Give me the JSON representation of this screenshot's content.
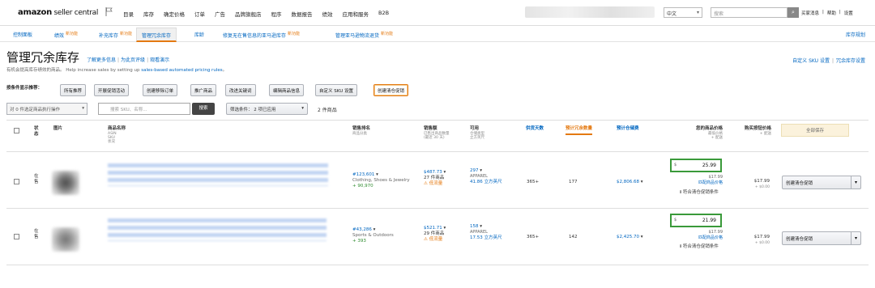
{
  "header": {
    "logo_main": "amazon",
    "logo_sub": " seller central",
    "nav": [
      "目录",
      "库存",
      "确定价格",
      "订单",
      "广告",
      "品牌旗舰店",
      "程序",
      "数据报告",
      "绩效",
      "应用和服务",
      "B2B"
    ],
    "language": "中文",
    "search_placeholder": "搜索",
    "links": [
      "买家消息",
      "帮助",
      "设置"
    ]
  },
  "tabs": [
    {
      "label": "控制面板",
      "badge": ""
    },
    {
      "label": "绩效",
      "badge": "新功能"
    },
    {
      "label": "补充库存",
      "badge": "新功能"
    },
    {
      "label": "管理冗余库存",
      "badge": ""
    },
    {
      "label": "库龄",
      "badge": ""
    },
    {
      "label": "修复无在售信息的亚马逊库存",
      "badge": "新功能"
    },
    {
      "label": "管理亚马逊物流退货",
      "badge": "新功能"
    }
  ],
  "tab_right": "库存规划",
  "page": {
    "title": "管理冗余库存",
    "link_learn": "了解更多信息",
    "link_rate": "为此页评级",
    "link_demo": "观看演示",
    "subtitle": "有机会提高库存绩效的商品。 Help increase sales by setting up ",
    "subtitle_link": "sales-based automated pricing rules",
    "subtitle_end": "。",
    "right_link_1": "自定义 SKU 设置",
    "right_link_2": "冗余库存设置"
  },
  "recommendations": {
    "label": "按条件显示推荐：",
    "buttons": [
      "所有推荐",
      "开展促销活动",
      "创建移除订单",
      "推广商品",
      "改进关键词",
      "编辑商品信息",
      "自定义 SKU 设置",
      "创建清仓促销"
    ],
    "selected": "创建清仓促销"
  },
  "toolbar": {
    "bulk": "对 0 件选定商品执行操作",
    "search_placeholder": "搜索 SKU、名称...",
    "search_button": "搜索",
    "filter": "筛选条件： 2 项已应用",
    "count": "2 件商品"
  },
  "columns": {
    "status": "状态",
    "image": "图片",
    "name": "商品名称",
    "name_sub": [
      "ASIN",
      "SKU",
      "状况"
    ],
    "rank": "销售排名",
    "rank_sub": "商品分类",
    "sales": "销售额",
    "sales_sub": "已售出商品数量",
    "sales_period": "(最近 30 天)",
    "available": "可用",
    "available_sub": [
      "仓储类型",
      "立方英尺"
    ],
    "supply_days": "供货天数",
    "excess_units": "预计冗余数量",
    "excess_cost": "预计仓储费",
    "your_price": "您的商品价格",
    "your_price_sub": [
      "最低价格",
      "+ 配送"
    ],
    "buybox": "购买按钮价格",
    "buybox_sub": "+ 配送",
    "save_all": "全部保存"
  },
  "rows": [
    {
      "status": "在售",
      "rank": "#123,601",
      "category": "Clothing, Shoes & Jewelry",
      "rank_change": "+ 90,970",
      "sales": "$487.73",
      "units": "27 件商品",
      "sales_warn": "低流量",
      "available": "297",
      "storage": "APPAREL",
      "cubic": "41.86 立方英尺",
      "supply_days": "365+",
      "excess_units": "177",
      "excess_cost": "$2,806.68",
      "currency": "$",
      "price": "25.99",
      "min_price": "$17.99",
      "match_link": "匹配商品价格",
      "eligible": "符合清仓促销条件",
      "buybox": "$17.99",
      "buybox_ship": "+ $0.00",
      "action": "创建清仓促销"
    },
    {
      "status": "在售",
      "rank": "#43,286",
      "category": "Sports & Outdoors",
      "rank_change": "+ 393",
      "sales": "$521.71",
      "units": "29 件商品",
      "sales_warn": "低流量",
      "available": "158",
      "storage": "APPAREL",
      "cubic": "17.53 立方英尺",
      "supply_days": "365+",
      "excess_units": "142",
      "excess_cost": "$2,425.70",
      "currency": "$",
      "price": "21.99",
      "min_price": "$17.99",
      "match_link": "匹配商品价格",
      "eligible": "符合清仓促销条件",
      "buybox": "$17.99",
      "buybox_ship": "+ $0.00",
      "action": "创建清仓促销"
    }
  ]
}
